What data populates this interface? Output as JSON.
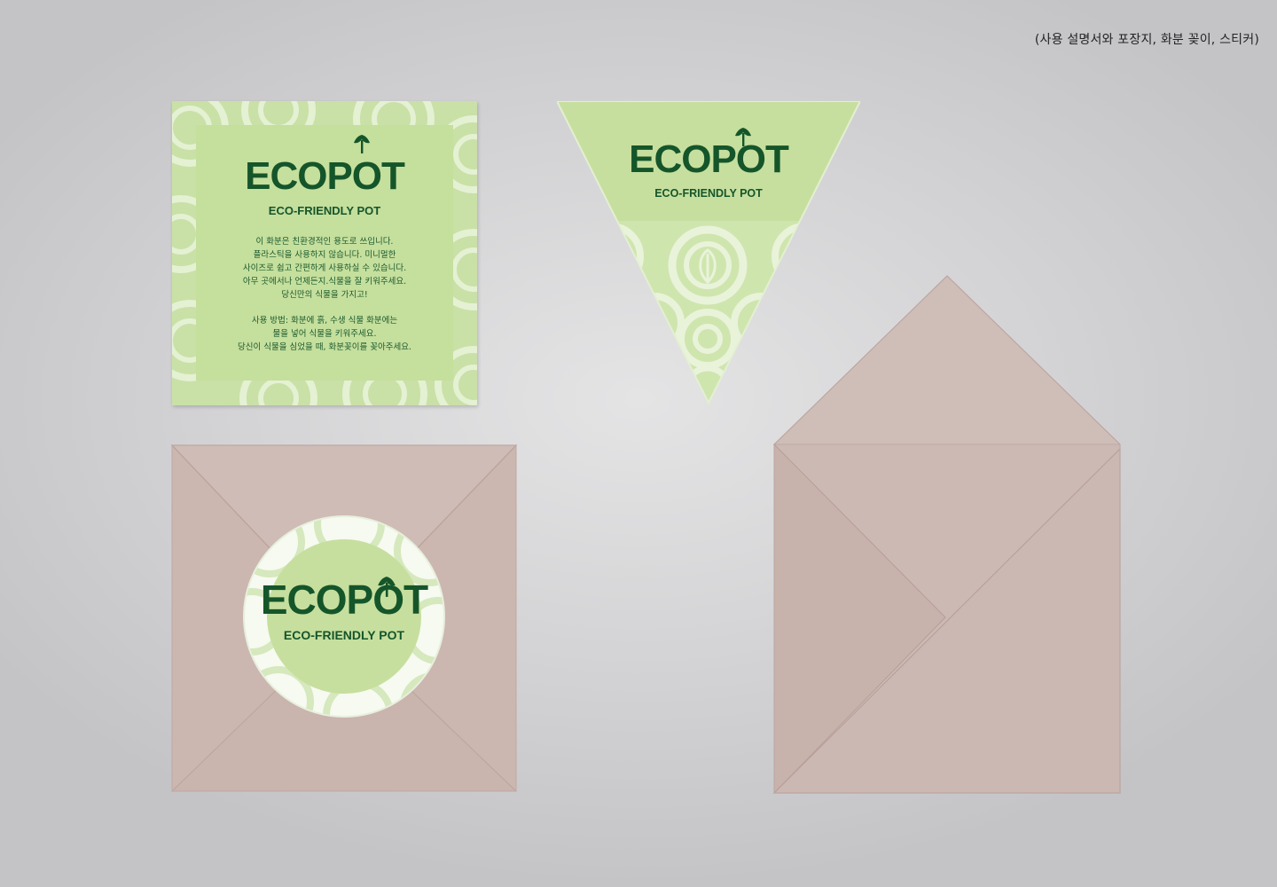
{
  "caption": "(사용 설명서와 포장지, 화분 꽂이, 스티커)",
  "brand": {
    "name": "ECOPOT",
    "tagline": "ECO-FRIENDLY POT",
    "color": "#15552a",
    "leaf_icon": "leaf-icon"
  },
  "card": {
    "paragraph1": [
      "이 화분은 친환경적인 용도로 쓰입니다.",
      "플라스틱을 사용하지 않습니다. 미니멀한",
      "사이즈로 쉽고 간편하게 사용하실 수 있습니다.",
      "아무 곳에서나 언제든지.식물을 잘 키워주세요.",
      "당신만의 식물을 가지고!"
    ],
    "paragraph2": [
      "사용 방법: 화분에 흙, 수생 식물 화분에는",
      "물을 넣어 식물을 키워주세요.",
      "당신이 식물을 심었을 때, 화분꽂이를 꽂아주세요."
    ]
  },
  "colors": {
    "envelope": "#cdb9b4",
    "envelope_flap": "#c4aea8",
    "card_green": "#c6df9e",
    "pattern_light": "#e6f1d5"
  }
}
